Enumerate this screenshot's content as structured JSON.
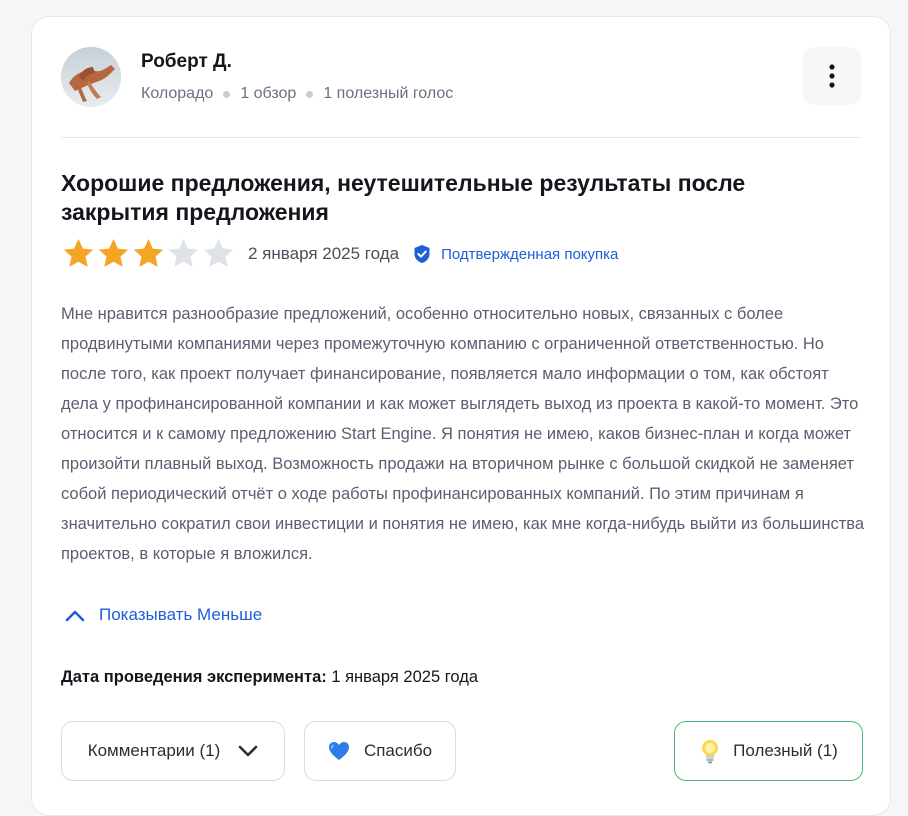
{
  "author": {
    "name": "Роберт Д.",
    "location": "Колорадо",
    "reviews_count": "1 обзор",
    "helpful_votes": "1 полезный голос"
  },
  "review": {
    "title": "Хорошие предложения, неутешительные результаты после закрытия предложения",
    "rating": 3,
    "rating_max": 5,
    "date": "2 января 2025 года",
    "verified_label": "Подтвержденная покупка",
    "body": "Мне нравится разнообразие предложений, особенно относительно новых, связанных с более продвинутыми компаниями через промежуточную компанию с ограниченной ответственностью. Но после того, как проект получает финансирование, появляется мало информации о том, как обстоят дела у профинансированной компании и как может выглядеть выход из проекта в какой-то момент. Это относится и к самому предложению Start Engine. Я понятия не имею, каков бизнес-план и когда может произойти плавный выход. Возможность продажи на вторичном рынке с большой скидкой не заменяет собой периодический отчёт о ходе работы профинансированных компаний. По этим причинам я значительно сократил свои инвестиции и понятия не имею, как мне когда-нибудь выйти из большинства проектов, в которые я вложился.",
    "toggle_label": "Показывать Меньше",
    "experiment_label": "Дата проведения эксперимента:",
    "experiment_date": "1 января 2025 года"
  },
  "actions": {
    "comments_label": "Комментарии (1)",
    "thanks_label": "Спасибо",
    "helpful_label": "Полезный (1)"
  },
  "colors": {
    "accent_blue": "#1e5fd8",
    "star_filled": "#f5a524",
    "star_empty": "#dfe2e7",
    "helpful_border": "#4cb878"
  },
  "icons": {
    "more": "more-vertical-icon",
    "verified": "shield-check-icon",
    "toggle": "chevron-up-icon",
    "comments": "chevron-down-icon",
    "thanks": "blue-heart-icon",
    "helpful": "lightbulb-icon"
  }
}
